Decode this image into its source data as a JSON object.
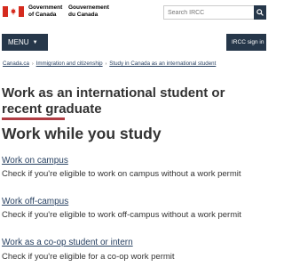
{
  "header": {
    "gov_en_line1": "Government",
    "gov_en_line2": "of Canada",
    "gov_fr_line1": "Gouvernement",
    "gov_fr_line2": "du Canada",
    "search_placeholder": "Search IRCC",
    "flag_colors": {
      "red": "#d52b1e",
      "white": "#ffffff"
    }
  },
  "menubar": {
    "menu_label": "MENU",
    "signin_label": "IRCC sign in",
    "bar_color": "#26374a"
  },
  "breadcrumb": [
    "Canada.ca",
    "Immigration and citizenship",
    "Study in Canada as an international student"
  ],
  "main": {
    "title": "Work as an international student or recent graduate",
    "subtitle": "Work while you study",
    "items": [
      {
        "link": "Work on campus",
        "desc": "Check if you're eligible to work on campus without a work permit"
      },
      {
        "link": "Work off-campus",
        "desc": "Check if you're eligible to work off-campus without a work permit"
      },
      {
        "link": "Work as a co-op student or intern",
        "desc": "Check if you're eligible for a co-op work permit"
      }
    ],
    "accent_color": "#af3c43",
    "link_color": "#284162"
  }
}
